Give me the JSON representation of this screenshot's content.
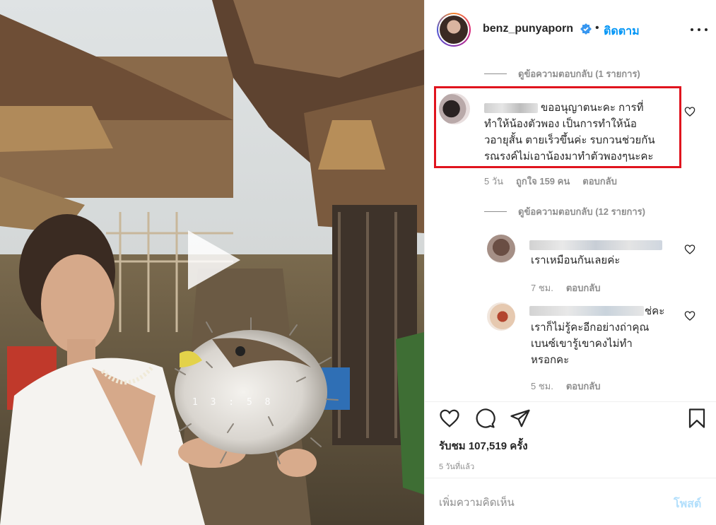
{
  "post": {
    "username": "benz_punyaporn",
    "follow_label": "ติดตาม",
    "separator": "•",
    "video_timestamp": "13:58",
    "views_label": "รับชม 107,519 ครั้ง",
    "time_ago": "5 วันที่แล้ว"
  },
  "comments": {
    "view_replies_top": "ดูข้อความตอบกลับ (1 รายการ)",
    "highlighted": {
      "lines": [
        "ขออนุญาตนะคะ การที่",
        "ทำให้น้องตัวพอง เป็นการทำให้น้อ",
        "วอายุสั้น ตายเร็วขึ้นค่ะ รบกวนช่วยกัน",
        "รณรงค์ไม่เอาน้องมาทำตัวพองๆนะคะ"
      ],
      "meta_time": "5 วัน",
      "meta_likes": "ถูกใจ 159 คน",
      "meta_reply": "ตอบกลับ"
    },
    "view_replies_mid": "ดูข้อความตอบกลับ (12 รายการ)",
    "reply1": {
      "lines": [
        "เราเหมือนกันเลยค่ะ"
      ],
      "meta_time": "7 ชม.",
      "meta_reply": "ตอบกลับ"
    },
    "reply2": {
      "first_line_tail": "ช่คะ",
      "lines": [
        "เราก็ไม่รู้คะอีกอย่างถ่าคุณ",
        "เบนซ์เขารู้เขาคงไม่ทำ",
        "หรอกคะ"
      ],
      "meta_time": "5 ชม.",
      "meta_reply": "ตอบกลับ"
    }
  },
  "composer": {
    "placeholder": "เพิ่มความคิดเห็น",
    "post_label": "โพสต์"
  },
  "colors": {
    "accent": "#0095f6",
    "highlight_box": "#e0141e",
    "muted": "#8e8e8e",
    "post_disabled": "#b2dffc"
  }
}
